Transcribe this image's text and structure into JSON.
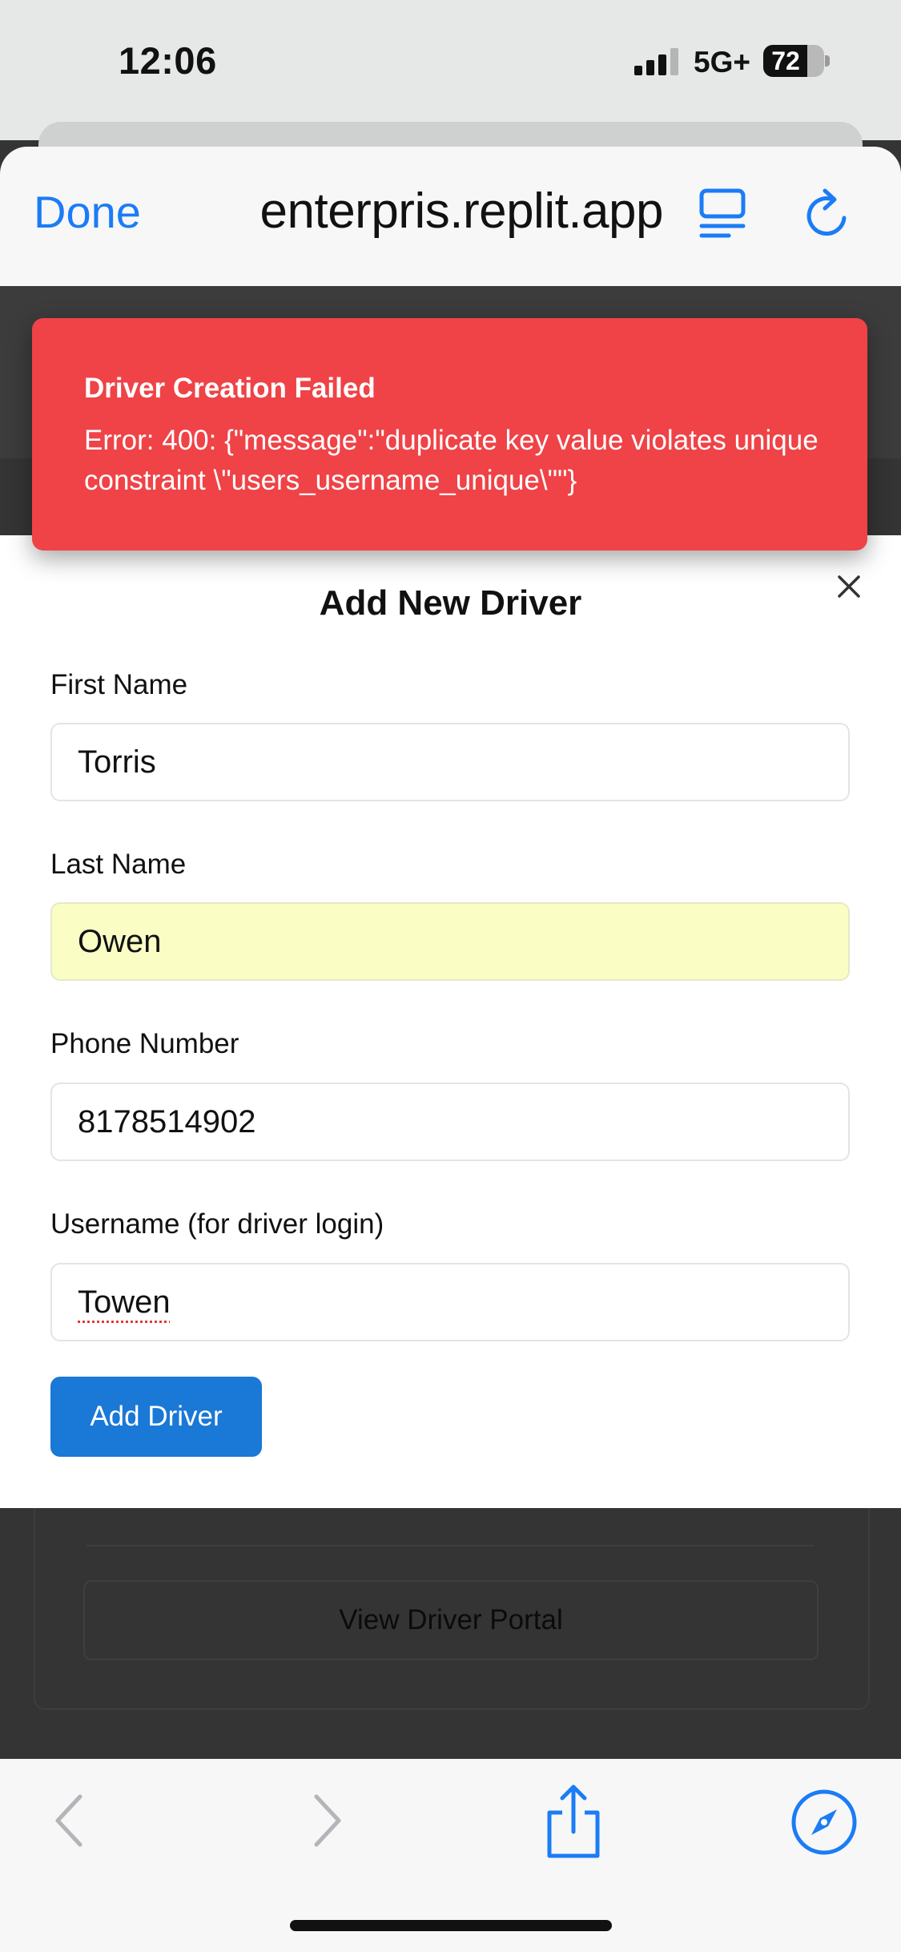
{
  "status_bar": {
    "time": "12:06",
    "network": "5G+",
    "battery": "72",
    "battery_level": 0.72
  },
  "browser": {
    "done_label": "Done",
    "url": "enterpris.replit.app"
  },
  "toast": {
    "title": "Driver Creation Failed",
    "message": "Error: 400: {\"message\":\"duplicate key value violates unique constraint \\\"users_username_unique\\\"\"}",
    "color": "#ef4347"
  },
  "modal": {
    "title": "Add New Driver",
    "fields": [
      {
        "label": "First Name",
        "value": "Torris"
      },
      {
        "label": "Last Name",
        "value": "Owen"
      },
      {
        "label": "Phone Number",
        "value": "8178514902"
      },
      {
        "label": "Username (for driver login)",
        "value": "Towen"
      }
    ],
    "submit_label": "Add Driver",
    "accent": "#1a78d6"
  },
  "background": {
    "portal_button": "View Driver Portal"
  },
  "toolbar": {
    "icons": [
      "back-icon",
      "forward-icon",
      "share-icon",
      "compass-icon"
    ]
  }
}
